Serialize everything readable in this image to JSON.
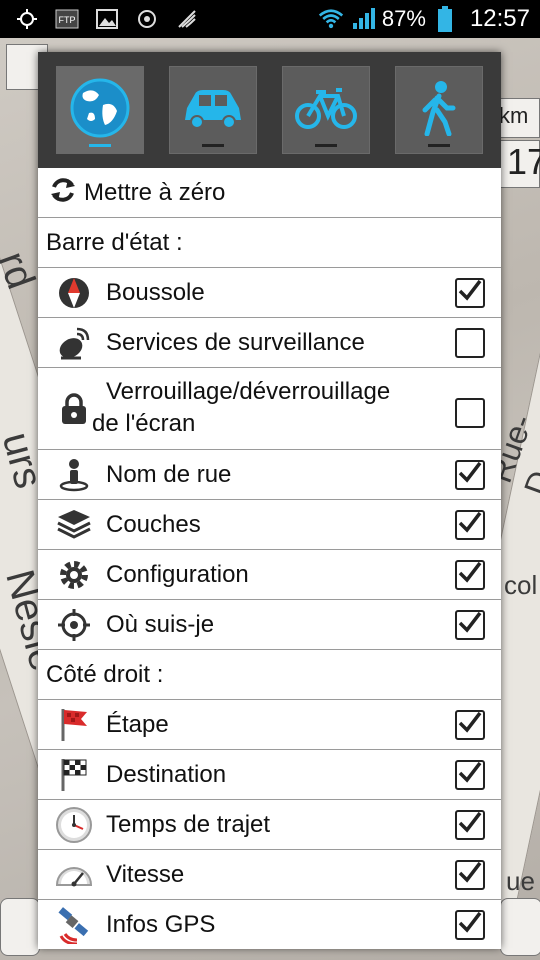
{
  "status_bar": {
    "icons": [
      "gps-icon",
      "ftp-icon",
      "image-icon",
      "sync-icon",
      "nfc-icon",
      "wifi-icon",
      "signal-icon",
      "battery-icon"
    ],
    "battery": "87%",
    "time": "12:57"
  },
  "map": {
    "labels": [
      "rd",
      "urs",
      "Nesle",
      "Rue-D",
      "km",
      "17",
      "col",
      "ue"
    ]
  },
  "tabs": [
    {
      "name": "globe",
      "active": true
    },
    {
      "name": "car",
      "active": false
    },
    {
      "name": "bicycle",
      "active": false
    },
    {
      "name": "pedestrian",
      "active": false
    }
  ],
  "reset_label": "Mettre à zéro",
  "section_status": "Barre d'état :",
  "status_items": [
    {
      "label": "Boussole",
      "icon": "compass-icon",
      "checked": true
    },
    {
      "label": "Services de surveillance",
      "icon": "monitoring-icon",
      "checked": false
    },
    {
      "label": "Verrouillage/déverrouillage",
      "label2": "de l'écran",
      "icon": "lock-icon",
      "checked": false
    },
    {
      "label": "Nom de rue",
      "icon": "street-name-icon",
      "checked": true
    },
    {
      "label": "Couches",
      "icon": "layers-icon",
      "checked": true
    },
    {
      "label": "Configuration",
      "icon": "gear-icon",
      "checked": true
    },
    {
      "label": "Où suis-je",
      "icon": "crosshair-icon",
      "checked": true
    }
  ],
  "section_right": "Côté droit :",
  "right_items": [
    {
      "label": "Étape",
      "icon": "flag-red-icon",
      "checked": true
    },
    {
      "label": "Destination",
      "icon": "checkered-flag-icon",
      "checked": true
    },
    {
      "label": "Temps de trajet",
      "icon": "clock-icon",
      "checked": true
    },
    {
      "label": "Vitesse",
      "icon": "speedometer-icon",
      "checked": true
    },
    {
      "label": "Infos GPS",
      "icon": "satellite-icon",
      "checked": true
    }
  ]
}
